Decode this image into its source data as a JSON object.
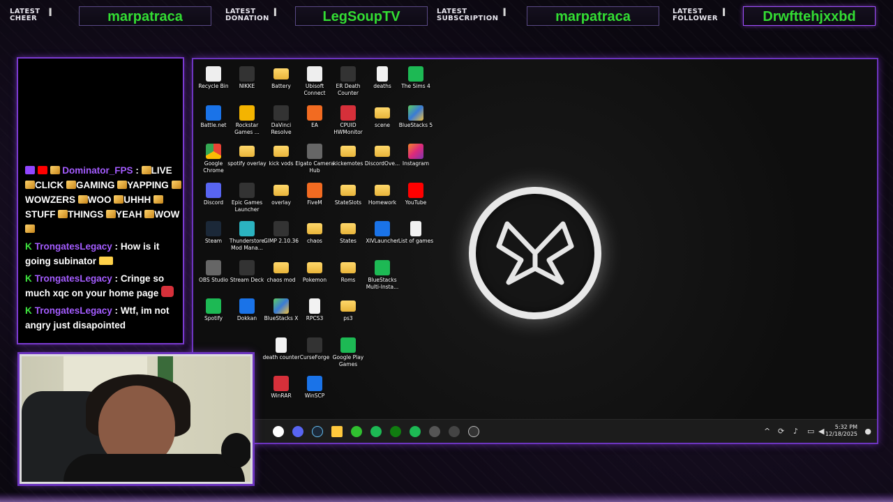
{
  "alerts": [
    {
      "label_line1": "LATEST",
      "label_line2": "CHEER",
      "value": "marpatraca"
    },
    {
      "label_line1": "LATEST",
      "label_line2": "DONATION",
      "value": "LegSoupTV"
    },
    {
      "label_line1": "LATEST",
      "label_line2": "SUBSCRIPTION",
      "value": "marpatraca"
    },
    {
      "label_line1": "LATEST",
      "label_line2": "FOLLOWER",
      "value": "Drwfttehjxxbd"
    }
  ],
  "chat": {
    "messages": [
      {
        "user": "Dominator_FPS",
        "sep": " :",
        "parts": [
          "LIVE",
          "CLICK",
          "GAMING",
          "YAPPING",
          "WOWZERS",
          "WOO",
          "UHHH",
          "STUFF",
          "THINGS",
          "YEAH",
          "WOW"
        ]
      },
      {
        "user": "TrongatesLegacy",
        "sep": " :",
        "text": "How is it going subinator"
      },
      {
        "user": "TrongatesLegacy",
        "sep": " :",
        "text": "Cringe so much xqc on your home page"
      },
      {
        "user": "TrongatesLegacy",
        "sep": " :",
        "text": "Wtf, im not angry just disapointed"
      }
    ]
  },
  "desktop": {
    "icons": [
      {
        "label": "Recycle Bin",
        "icon": "recycle-bin-icon",
        "style": "g-white"
      },
      {
        "label": "NIKKE",
        "icon": "nikke-icon",
        "style": "g-dark"
      },
      {
        "label": "Battery",
        "icon": "folder-icon",
        "style": "g-folder"
      },
      {
        "label": "Ubisoft Connect",
        "icon": "ubisoft-icon",
        "style": "g-white"
      },
      {
        "label": "ER Death Counter",
        "icon": "shortcut-icon",
        "style": "g-dark"
      },
      {
        "label": "deaths",
        "icon": "file-icon",
        "style": "g-file"
      },
      {
        "label": "The Sims 4",
        "icon": "sims-icon",
        "style": "g-green"
      },
      {
        "label": "Battle.net",
        "icon": "battlenet-icon",
        "style": "g-blue"
      },
      {
        "label": "Rockstar Games ...",
        "icon": "rockstar-icon",
        "style": "g-gold"
      },
      {
        "label": "DaVinci Resolve",
        "icon": "davinci-icon",
        "style": "g-dark"
      },
      {
        "label": "EA",
        "icon": "ea-icon",
        "style": "g-orange"
      },
      {
        "label": "CPUID HWMonitor",
        "icon": "hwmonitor-icon",
        "style": "g-red"
      },
      {
        "label": "scene",
        "icon": "folder-icon",
        "style": "g-folder"
      },
      {
        "label": "BlueStacks 5",
        "icon": "bluestacks-icon",
        "style": "g-bs"
      },
      {
        "label": "Google Chrome",
        "icon": "chrome-icon",
        "style": "g-chrome"
      },
      {
        "label": "spotify overlay",
        "icon": "folder-icon",
        "style": "g-folder"
      },
      {
        "label": "kick vods",
        "icon": "folder-icon",
        "style": "g-folder"
      },
      {
        "label": "Elgato Camera Hub",
        "icon": "elgato-icon",
        "style": "g-grey"
      },
      {
        "label": "kickemotes",
        "icon": "folder-icon",
        "style": "g-folder"
      },
      {
        "label": "DiscordOve...",
        "icon": "folder-icon",
        "style": "g-folder"
      },
      {
        "label": "Instagram",
        "icon": "instagram-icon",
        "style": "g-insta"
      },
      {
        "label": "Discord",
        "icon": "discord-icon",
        "style": "g-purple"
      },
      {
        "label": "Epic Games Launcher",
        "icon": "epic-icon",
        "style": "g-dark"
      },
      {
        "label": "overlay",
        "icon": "folder-icon",
        "style": "g-folder"
      },
      {
        "label": "FiveM",
        "icon": "fivem-icon",
        "style": "g-orange"
      },
      {
        "label": "StateSlots",
        "icon": "folder-icon",
        "style": "g-folder"
      },
      {
        "label": "Homework",
        "icon": "folder-icon",
        "style": "g-folder"
      },
      {
        "label": "YouTube",
        "icon": "youtube-icon",
        "style": "g-yt"
      },
      {
        "label": "Steam",
        "icon": "steam-icon",
        "style": "g-steam"
      },
      {
        "label": "Thunderstore Mod Mana...",
        "icon": "thunderstore-icon",
        "style": "g-teal"
      },
      {
        "label": "GIMP 2.10.36",
        "icon": "gimp-icon",
        "style": "g-dark"
      },
      {
        "label": "chaos",
        "icon": "folder-icon",
        "style": "g-folder"
      },
      {
        "label": "States",
        "icon": "folder-icon",
        "style": "g-folder"
      },
      {
        "label": "XIVLauncher",
        "icon": "xivlauncher-icon",
        "style": "g-blue"
      },
      {
        "label": "List of games",
        "icon": "file-icon",
        "style": "g-file"
      },
      {
        "label": "OBS Studio",
        "icon": "obs-icon",
        "style": "g-grey"
      },
      {
        "label": "Stream Deck",
        "icon": "streamdeck-icon",
        "style": "g-dark"
      },
      {
        "label": "chaos mod",
        "icon": "folder-icon",
        "style": "g-folder"
      },
      {
        "label": "Pokemon",
        "icon": "folder-icon",
        "style": "g-folder"
      },
      {
        "label": "Roms",
        "icon": "folder-icon",
        "style": "g-folder"
      },
      {
        "label": "BlueStacks Multi-Insta...",
        "icon": "bluestacks-multi-icon",
        "style": "g-green"
      },
      {
        "label": "Spotify",
        "icon": "spotify-icon",
        "style": "g-green"
      },
      {
        "label": "Dokkan",
        "icon": "dokkan-icon",
        "style": "g-blue"
      },
      {
        "label": "BlueStacks X",
        "icon": "bluestacks-x-icon",
        "style": "g-bs"
      },
      {
        "label": "RPCS3",
        "icon": "file-icon",
        "style": "g-file"
      },
      {
        "label": "ps3",
        "icon": "folder-icon",
        "style": "g-folder"
      },
      {
        "label": "death counter",
        "icon": "file-icon",
        "style": "g-file"
      },
      {
        "label": "CurseForge",
        "icon": "curseforge-icon",
        "style": "g-dark"
      },
      {
        "label": "Google Play Games",
        "icon": "google-play-games-icon",
        "style": "g-green"
      },
      {
        "label": "WinRAR",
        "icon": "winrar-icon",
        "style": "g-red"
      },
      {
        "label": "WinSCP",
        "icon": "winscp-icon",
        "style": "g-blue"
      }
    ],
    "taskbar": {
      "time": "5:32 PM",
      "date": "12/18/2025"
    }
  }
}
